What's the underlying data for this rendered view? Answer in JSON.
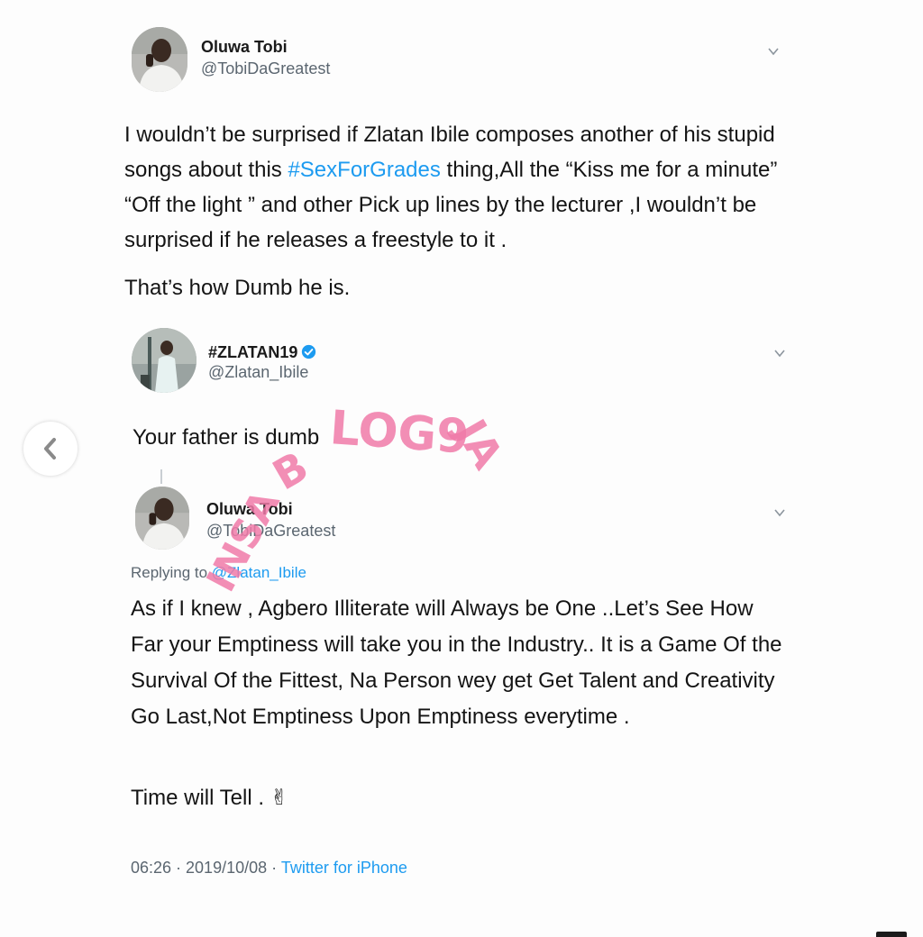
{
  "tweet1": {
    "display_name": "Oluwa Tobi",
    "handle": "@TobiDaGreatest",
    "text_parts": {
      "before": "I wouldn’t be surprised if Zlatan Ibile composes another of his stupid songs about this ",
      "hashtag": "#SexForGrades",
      "after": "  thing,All the “Kiss me for a minute” “Off the light ” and other Pick up lines by the lecturer ,I wouldn’t be surprised if he releases a freestyle to it ."
    },
    "text_line2": "That’s how Dumb he is."
  },
  "tweet2": {
    "display_name": "#ZLATAN19",
    "handle": "@Zlatan_Ibile",
    "text": "Your father is dumb"
  },
  "tweet3": {
    "display_name": "Oluwa Tobi",
    "handle": "@TobiDaGreatest",
    "replying_prefix": "Replying to ",
    "replying_to": "@Zlatan_Ibile",
    "text": "As if I knew , Agbero Illiterate will Always be One ..Let’s See How Far your Emptiness will take you in the Industry.. It is a Game Of the Survival Of the Fittest, Na Person wey get Get Talent and Creativity Go Last,Not Emptiness Upon Emptiness everytime .",
    "text_line2": "Time will Tell . ✌",
    "time": "06:26 · 2019/10/08 · ",
    "source": "Twitter for iPhone"
  },
  "watermark": {
    "text": "INSABLOG9JA",
    "color": "#f07aa8"
  },
  "colors": {
    "link": "#1d9bf0",
    "secondary": "#5b6670",
    "verified": "#1d9bf0"
  },
  "icons": {
    "back": "chevron-left-icon",
    "caret": "chevron-down-icon",
    "verified": "verified-badge-icon"
  }
}
